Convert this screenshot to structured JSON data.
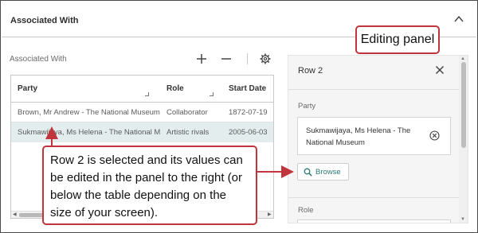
{
  "section": {
    "title": "Associated With",
    "collapse_icon": "chevron-up-icon"
  },
  "grid": {
    "label": "Associated With",
    "toolbar": {
      "add_icon": "plus-icon",
      "remove_icon": "minus-icon",
      "settings_icon": "gear-icon"
    },
    "columns": [
      "Party",
      "Role",
      "Start Date"
    ],
    "rows": [
      {
        "party": "Brown, Mr Andrew - The National Museum",
        "role": "Collaborator",
        "start_date": "1872-07-19"
      },
      {
        "party": "Sukmawijaya, Ms Helena - The National Museum",
        "role": "Artistic rivals",
        "start_date": "2005-06-03"
      }
    ],
    "selected_row": 2
  },
  "panel": {
    "title": "Row 2",
    "close_icon": "close-icon",
    "party_label": "Party",
    "party_value": "Sukmawijaya, Ms Helena - The National Museum",
    "clear_icon": "clear-circle-icon",
    "browse_label": "Browse",
    "browse_icon": "search-icon",
    "role_label": "Role"
  },
  "callouts": {
    "editing_panel": "Editing panel",
    "row_selected_lines": [
      "Row 2 is selected and its values can",
      "be edited in the panel to the right (or",
      "below the table depending on the",
      "size of your screen)."
    ]
  },
  "colors": {
    "callout_border": "#c0353b",
    "selected_row": "#e3eded",
    "accent": "#2c7a72"
  }
}
